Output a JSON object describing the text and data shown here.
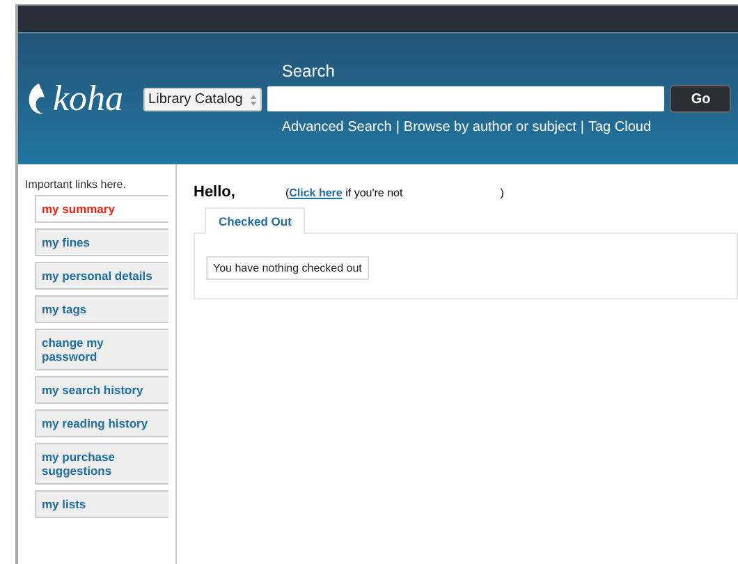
{
  "header": {
    "logo": "koha",
    "search_label": "Search",
    "scope_select": "Library Catalog",
    "go_button": "Go",
    "links": [
      "Advanced Search",
      "Browse by author or subject",
      "Tag Cloud"
    ],
    "link_separator": "|"
  },
  "sidebar": {
    "note": "Important links here.",
    "items": [
      {
        "label": "my summary",
        "selected": true
      },
      {
        "label": "my fines",
        "selected": false
      },
      {
        "label": "my personal details",
        "selected": false
      },
      {
        "label": "my tags",
        "selected": false
      },
      {
        "label": "change my password",
        "selected": false
      },
      {
        "label": "my search history",
        "selected": false
      },
      {
        "label": "my reading history",
        "selected": false
      },
      {
        "label": "my purchase suggestions",
        "selected": false
      },
      {
        "label": "my lists",
        "selected": false
      }
    ]
  },
  "main": {
    "greeting": "Hello,",
    "not_you": {
      "open": "(",
      "link": "Click here",
      "text": "if you're not",
      "close": ")"
    },
    "tabs": [
      {
        "label": "Checked Out",
        "selected": true
      }
    ],
    "message": "You have nothing checked out"
  }
}
